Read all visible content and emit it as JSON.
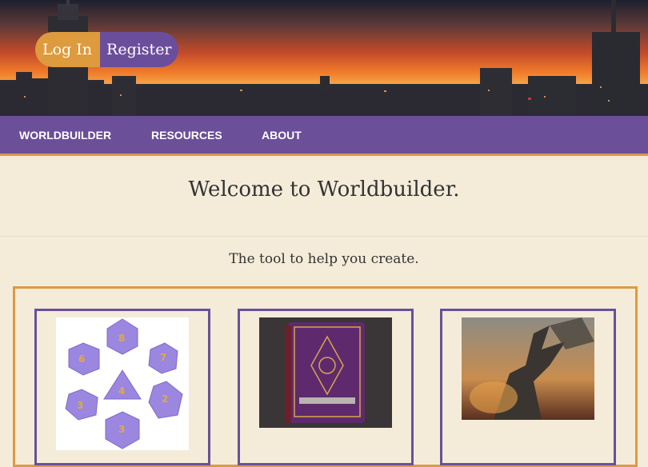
{
  "auth": {
    "login_label": "Log In",
    "register_label": "Register"
  },
  "nav": {
    "items": [
      {
        "label": "WORLDBUILDER"
      },
      {
        "label": "RESOURCES"
      },
      {
        "label": "ABOUT"
      }
    ]
  },
  "main": {
    "title": "Welcome to Worldbuilder.",
    "tagline": "The tool to help you create."
  },
  "colors": {
    "accent_orange": "#dc9a45",
    "brand_purple": "#6b4f99",
    "background": "#f4ecd9"
  },
  "cards": [
    {
      "icon": "dice-image"
    },
    {
      "icon": "book-image"
    },
    {
      "icon": "dragon-image"
    }
  ]
}
